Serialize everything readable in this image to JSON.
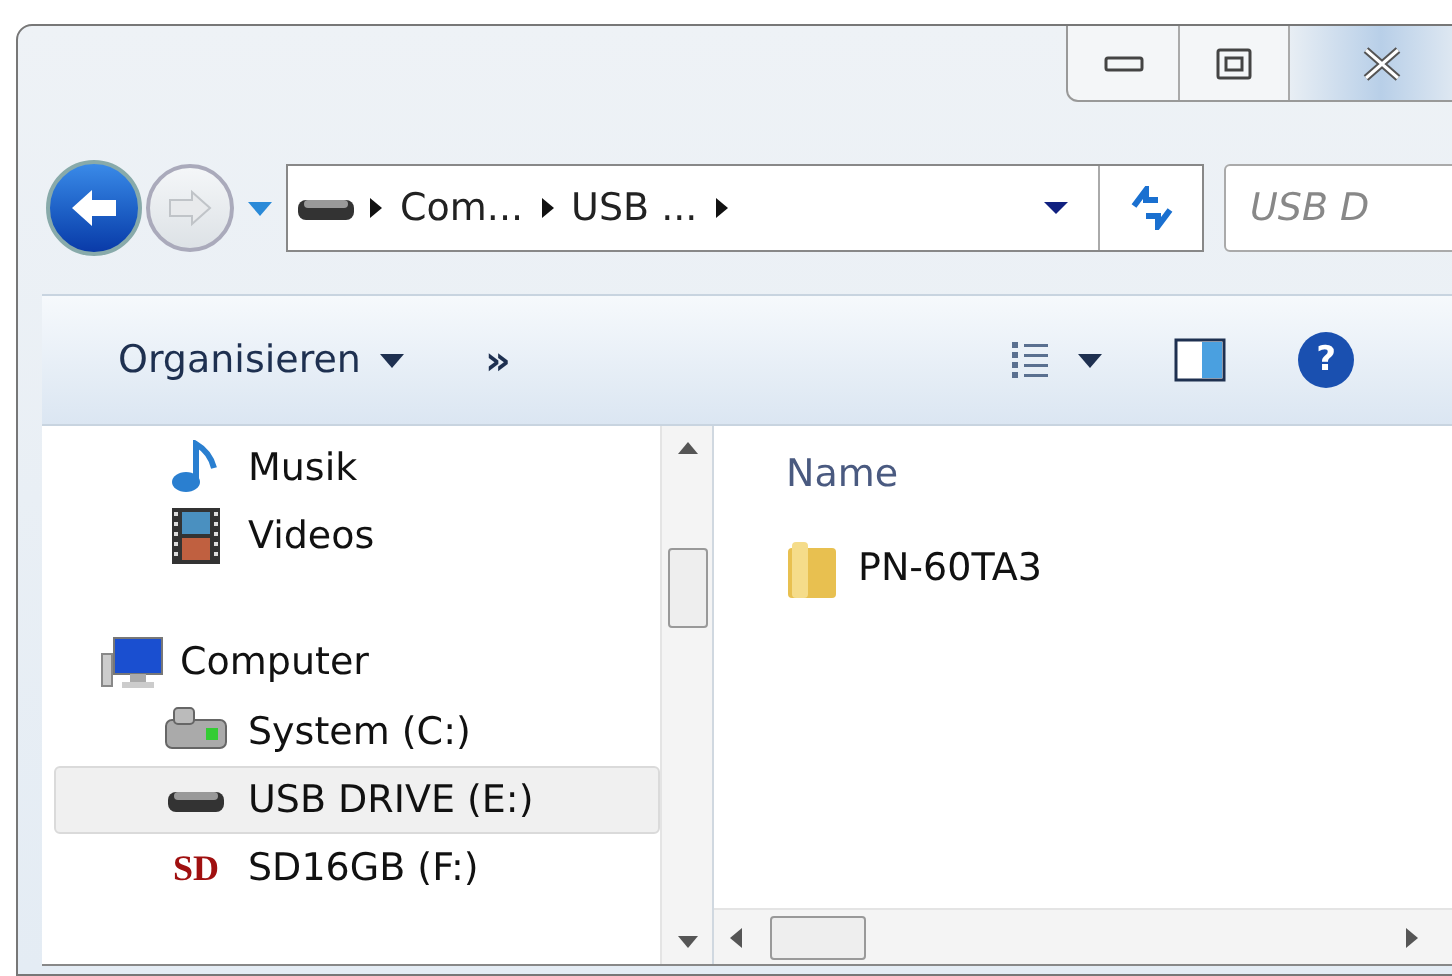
{
  "window": {
    "caption_buttons": [
      {
        "kind": "minimize"
      },
      {
        "kind": "maximize"
      },
      {
        "kind": "close"
      }
    ]
  },
  "navigation": {
    "back_enabled": true,
    "forward_enabled": false
  },
  "address_bar": {
    "crumbs": [
      "Com...",
      "USB ..."
    ]
  },
  "search": {
    "placeholder": "USB D"
  },
  "toolbar": {
    "organize": "Organisieren",
    "more": "»",
    "help": "?"
  },
  "nav_pane": {
    "sections": [
      {
        "items": [
          {
            "label": "Musik",
            "kind": "music",
            "selected": false
          },
          {
            "label": "Videos",
            "kind": "video",
            "selected": false
          }
        ]
      },
      {
        "label": "Computer",
        "kind": "computer",
        "selected": false,
        "children": [
          {
            "label": "System (C:)",
            "kind": "hdd",
            "selected": false
          },
          {
            "label": "USB DRIVE (E:)",
            "kind": "usb",
            "selected": true
          },
          {
            "label": "SD16GB (F:)",
            "kind": "sd",
            "badge": "SD",
            "selected": false
          }
        ]
      }
    ]
  },
  "content": {
    "column": "Name",
    "files": [
      {
        "name": "PN-60TA3",
        "kind": "folder"
      }
    ]
  }
}
